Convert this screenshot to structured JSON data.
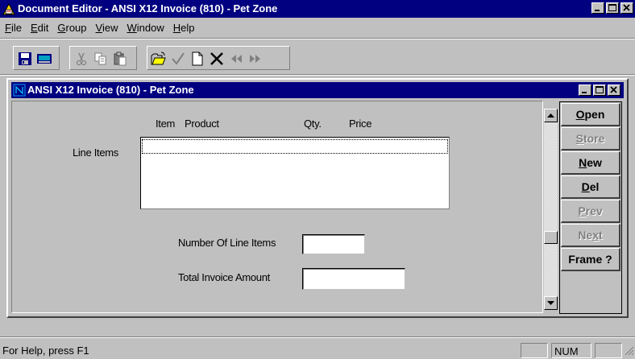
{
  "app": {
    "title": "Document Editor - ANSI X12 Invoice (810) - Pet Zone"
  },
  "menu": [
    {
      "mnemonic": "F",
      "rest": "ile"
    },
    {
      "mnemonic": "E",
      "rest": "dit"
    },
    {
      "mnemonic": "G",
      "rest": "roup"
    },
    {
      "mnemonic": "V",
      "rest": "iew"
    },
    {
      "mnemonic": "W",
      "rest": "indow"
    },
    {
      "mnemonic": "H",
      "rest": "elp"
    }
  ],
  "toolbar": {
    "buttons": [
      "save-icon",
      "keyboard-icon",
      "cut-icon",
      "copy-icon",
      "paste-icon",
      "open-folder-icon",
      "checkmark-icon",
      "new-document-icon",
      "delete-x-icon",
      "rewind-icon",
      "fast-forward-icon"
    ]
  },
  "document": {
    "title": "ANSI X12 Invoice (810) - Pet Zone",
    "columns": {
      "item": "Item",
      "product": "Product",
      "qty": "Qty.",
      "price": "Price"
    },
    "line_items_label": "Line Items",
    "num_line_items_label": "Number Of Line Items",
    "num_line_items_value": "",
    "total_label": "Total Invoice Amount",
    "total_value": ""
  },
  "side_buttons": [
    {
      "label_pre": "",
      "mnemonic": "O",
      "label_post": "pen",
      "enabled": true
    },
    {
      "label_pre": "",
      "mnemonic": "S",
      "label_post": "tore",
      "enabled": false
    },
    {
      "label_pre": "",
      "mnemonic": "N",
      "label_post": "ew",
      "enabled": true
    },
    {
      "label_pre": "",
      "mnemonic": "D",
      "label_post": "el",
      "enabled": true
    },
    {
      "label_pre": "",
      "mnemonic": "P",
      "label_post": "rev",
      "enabled": false
    },
    {
      "label_pre": "Ne",
      "mnemonic": "x",
      "label_post": "t",
      "enabled": false
    },
    {
      "label_pre": "Frame ?",
      "mnemonic": "",
      "label_post": "",
      "enabled": true
    }
  ],
  "status": {
    "help_text": "For Help, press F1",
    "num_indicator": "NUM"
  },
  "colors": {
    "titlebar": "#000080",
    "face": "#c0c0c0"
  }
}
